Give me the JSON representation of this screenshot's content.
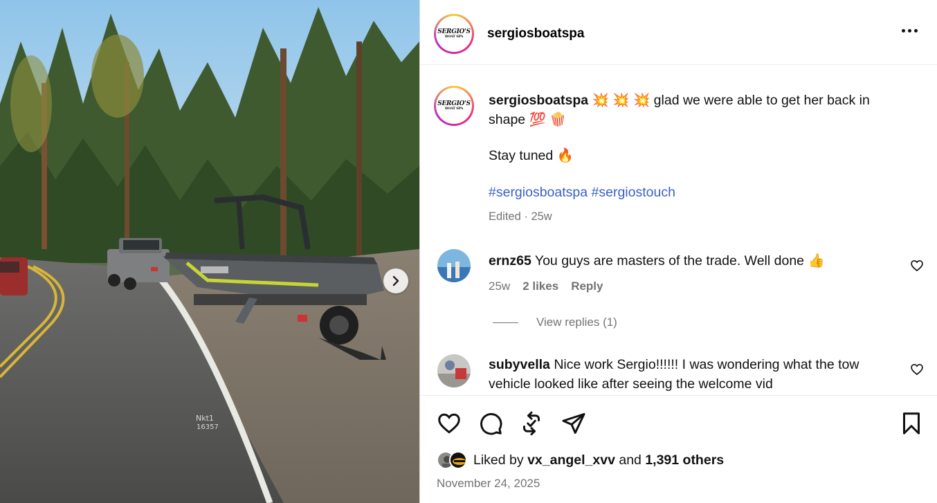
{
  "post": {
    "username": "sergiosboatspa",
    "logo_text": "SERGIO'S",
    "logo_sub": "BOAT SPA",
    "more_icon": "more-horizontal-icon"
  },
  "caption": {
    "username": "sergiosboatspa",
    "emojis_lead": "💥 💥 💥",
    "text": "glad we were able to get her back in shape",
    "emojis_tail": "💯 🍿",
    "line2_text": "Stay tuned",
    "line2_emoji": "🔥",
    "hashtags": [
      "#sergiosboatspa",
      "#sergiostouch"
    ],
    "edited": "Edited · 25w"
  },
  "comments": [
    {
      "username": "ernz65",
      "text": "You guys are masters of the trade. Well done",
      "emoji": "👍",
      "time": "25w",
      "likes": "2 likes",
      "reply": "Reply",
      "view_replies": "View replies (1)"
    },
    {
      "username": "subyvella",
      "text": "Nice work Sergio!!!!!! I was wondering what the tow vehicle looked like after seeing the welcome vid"
    }
  ],
  "likes": {
    "prefix": "Liked by",
    "user": "vx_angel_xvv",
    "middle": "and",
    "others": "1,391 others"
  },
  "date": "November 24, 2025",
  "colors": {
    "hashtag": "#3b5fc7",
    "meta": "#737373",
    "avatar_ring": [
      "#f9ce34",
      "#ee2a7b",
      "#b92cc9"
    ]
  }
}
